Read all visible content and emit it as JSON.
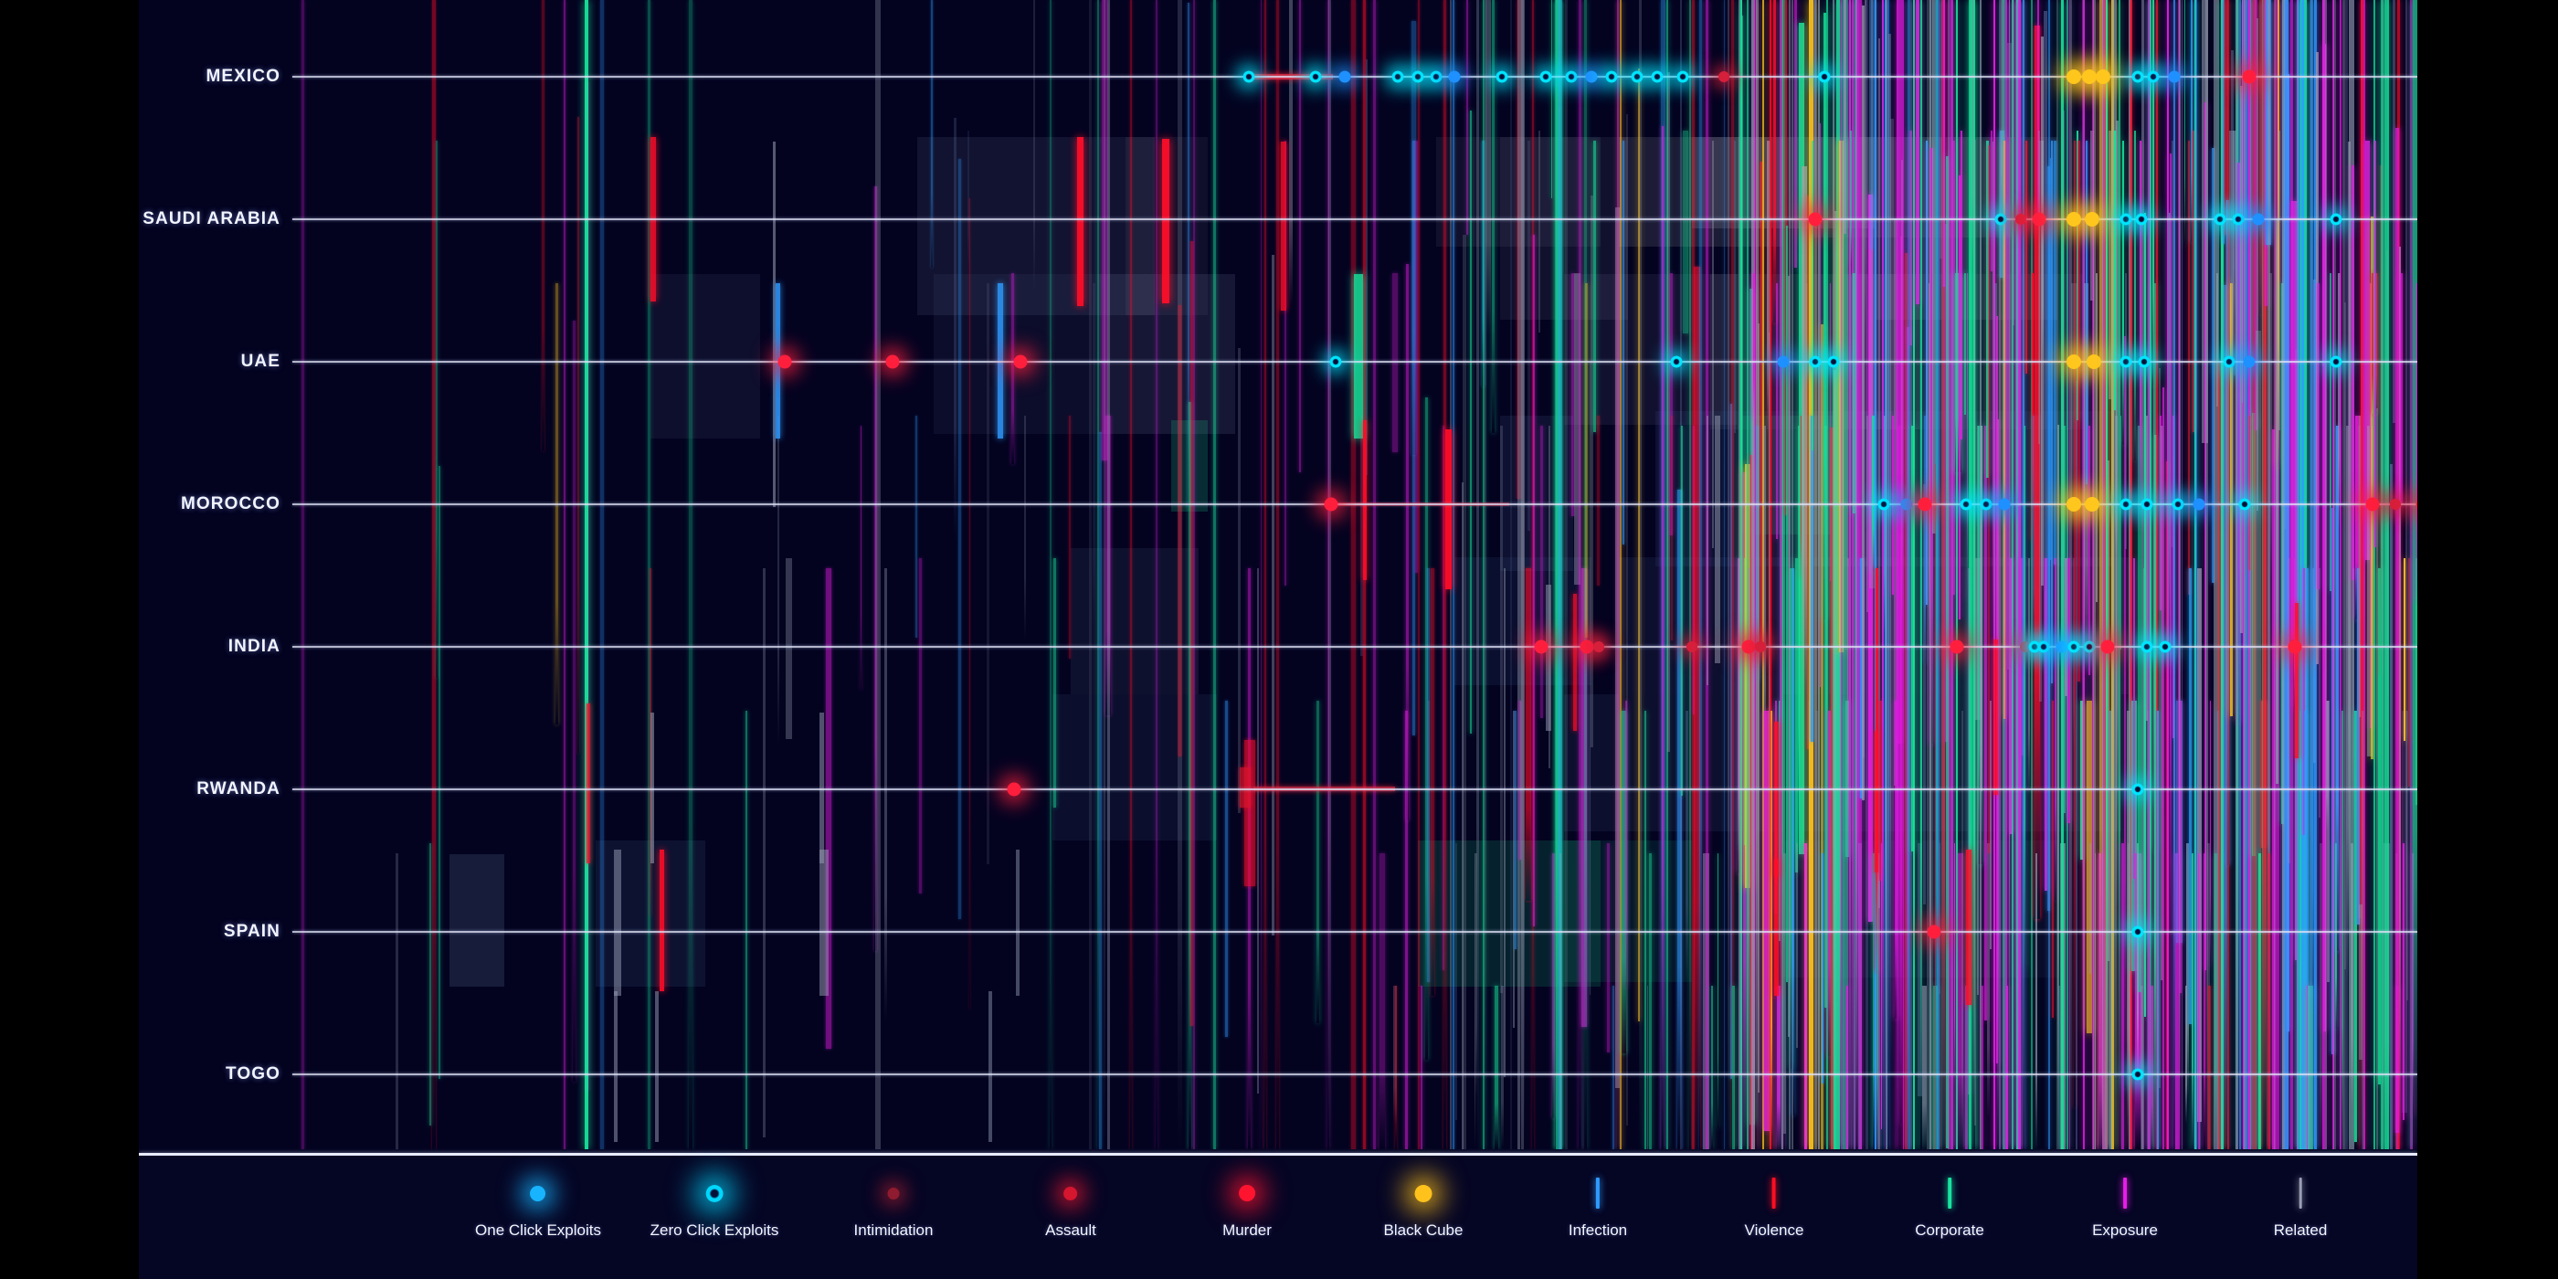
{
  "theme": {
    "letterbox": "#000000",
    "panel_bg": "#030320",
    "legend_bg": "#050524",
    "gridline": "#e1e4f8",
    "label_color": "#f2f4ff"
  },
  "chart_data": {
    "type": "timeline",
    "title": "",
    "xlabel": "",
    "ylabel": "",
    "grid": true,
    "legend_position": "bottom",
    "categories": [
      "MEXICO",
      "SAUDI ARABIA",
      "UAE",
      "MOROCCO",
      "INDIA",
      "RWANDA",
      "SPAIN",
      "TOGO"
    ],
    "series": [
      {
        "name": "One Click Exploits",
        "color": "#1e90ff",
        "marker": "dot",
        "size": 13
      },
      {
        "name": "Zero Click Exploits",
        "color": "#00e5ff",
        "marker": "ring",
        "size": 13
      },
      {
        "name": "Intimidation",
        "color": "#8b1c33",
        "marker": "dot",
        "size": 10
      },
      {
        "name": "Assault",
        "color": "#d61f3a",
        "marker": "dot",
        "size": 12
      },
      {
        "name": "Murder",
        "color": "#ff1f3d",
        "marker": "dot",
        "size": 15
      },
      {
        "name": "Black Cube",
        "color": "#ffc61e",
        "marker": "dot",
        "size": 16
      },
      {
        "name": "Infection",
        "color": "#2f9bff",
        "marker": "line",
        "size": 4
      },
      {
        "name": "Violence",
        "color": "#ff0d29",
        "marker": "line",
        "size": 4
      },
      {
        "name": "Corporate",
        "color": "#18e39a",
        "marker": "line",
        "size": 4
      },
      {
        "name": "Exposure",
        "color": "#e11de1",
        "marker": "line",
        "size": 4
      },
      {
        "name": "Related",
        "color": "#9aa0b5",
        "marker": "line",
        "size": 3
      }
    ]
  },
  "rows": [
    {
      "label": "MEXICO"
    },
    {
      "label": "SAUDI ARABIA"
    },
    {
      "label": "UAE"
    },
    {
      "label": "MOROCCO"
    },
    {
      "label": "INDIA"
    },
    {
      "label": "RWANDA"
    },
    {
      "label": "SPAIN"
    },
    {
      "label": "TOGO"
    }
  ],
  "legend": {
    "items": [
      {
        "label": "One Click Exploits",
        "marker": "dot",
        "color": "#18b4ff",
        "size": 17
      },
      {
        "label": "Zero Click Exploits",
        "marker": "ring",
        "color": "#00d8ff",
        "size": 19
      },
      {
        "label": "Intimidation",
        "marker": "dot",
        "color": "#8e1b2f",
        "size": 13
      },
      {
        "label": "Assault",
        "marker": "dot",
        "color": "#d4162f",
        "size": 15
      },
      {
        "label": "Murder",
        "marker": "dot",
        "color": "#ff1430",
        "size": 18
      },
      {
        "label": "Black Cube",
        "marker": "dot",
        "color": "#ffc21c",
        "size": 19
      },
      {
        "label": "Infection",
        "marker": "line",
        "color": "#2f9bff",
        "size": 4
      },
      {
        "label": "Violence",
        "marker": "line",
        "color": "#ff0d20",
        "size": 4
      },
      {
        "label": "Corporate",
        "marker": "line",
        "color": "#18e3a0",
        "size": 4
      },
      {
        "label": "Exposure",
        "marker": "line",
        "color": "#e81de8",
        "size": 4
      },
      {
        "label": "Related",
        "marker": "line",
        "color": "#9aa0b5",
        "size": 3
      }
    ]
  }
}
